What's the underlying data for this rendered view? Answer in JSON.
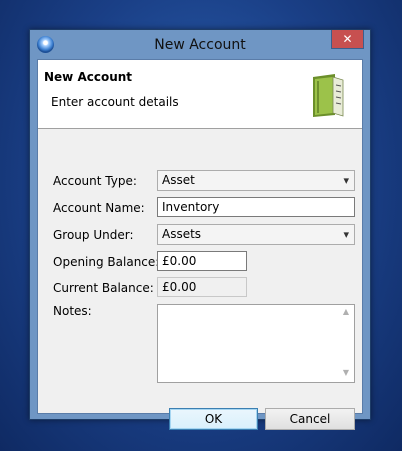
{
  "window": {
    "title": "New Account",
    "close_glyph": "✕"
  },
  "header": {
    "title": "New Account",
    "subtitle": "Enter account details",
    "icon": "ledger-book-icon"
  },
  "form": {
    "account_type": {
      "label": "Account Type:",
      "value": "Asset"
    },
    "account_name": {
      "label": "Account Name:",
      "value": "Inventory"
    },
    "group_under": {
      "label": "Group Under:",
      "value": "Assets"
    },
    "opening_balance": {
      "label": "Opening Balance:",
      "value": "£0.00"
    },
    "current_balance": {
      "label": "Current Balance:",
      "value": "£0.00"
    },
    "notes": {
      "label": "Notes:",
      "value": ""
    }
  },
  "buttons": {
    "ok": "OK",
    "cancel": "Cancel"
  },
  "icons": {
    "dropdown": "▾",
    "scroll_up": "▲",
    "scroll_down": "▼"
  }
}
